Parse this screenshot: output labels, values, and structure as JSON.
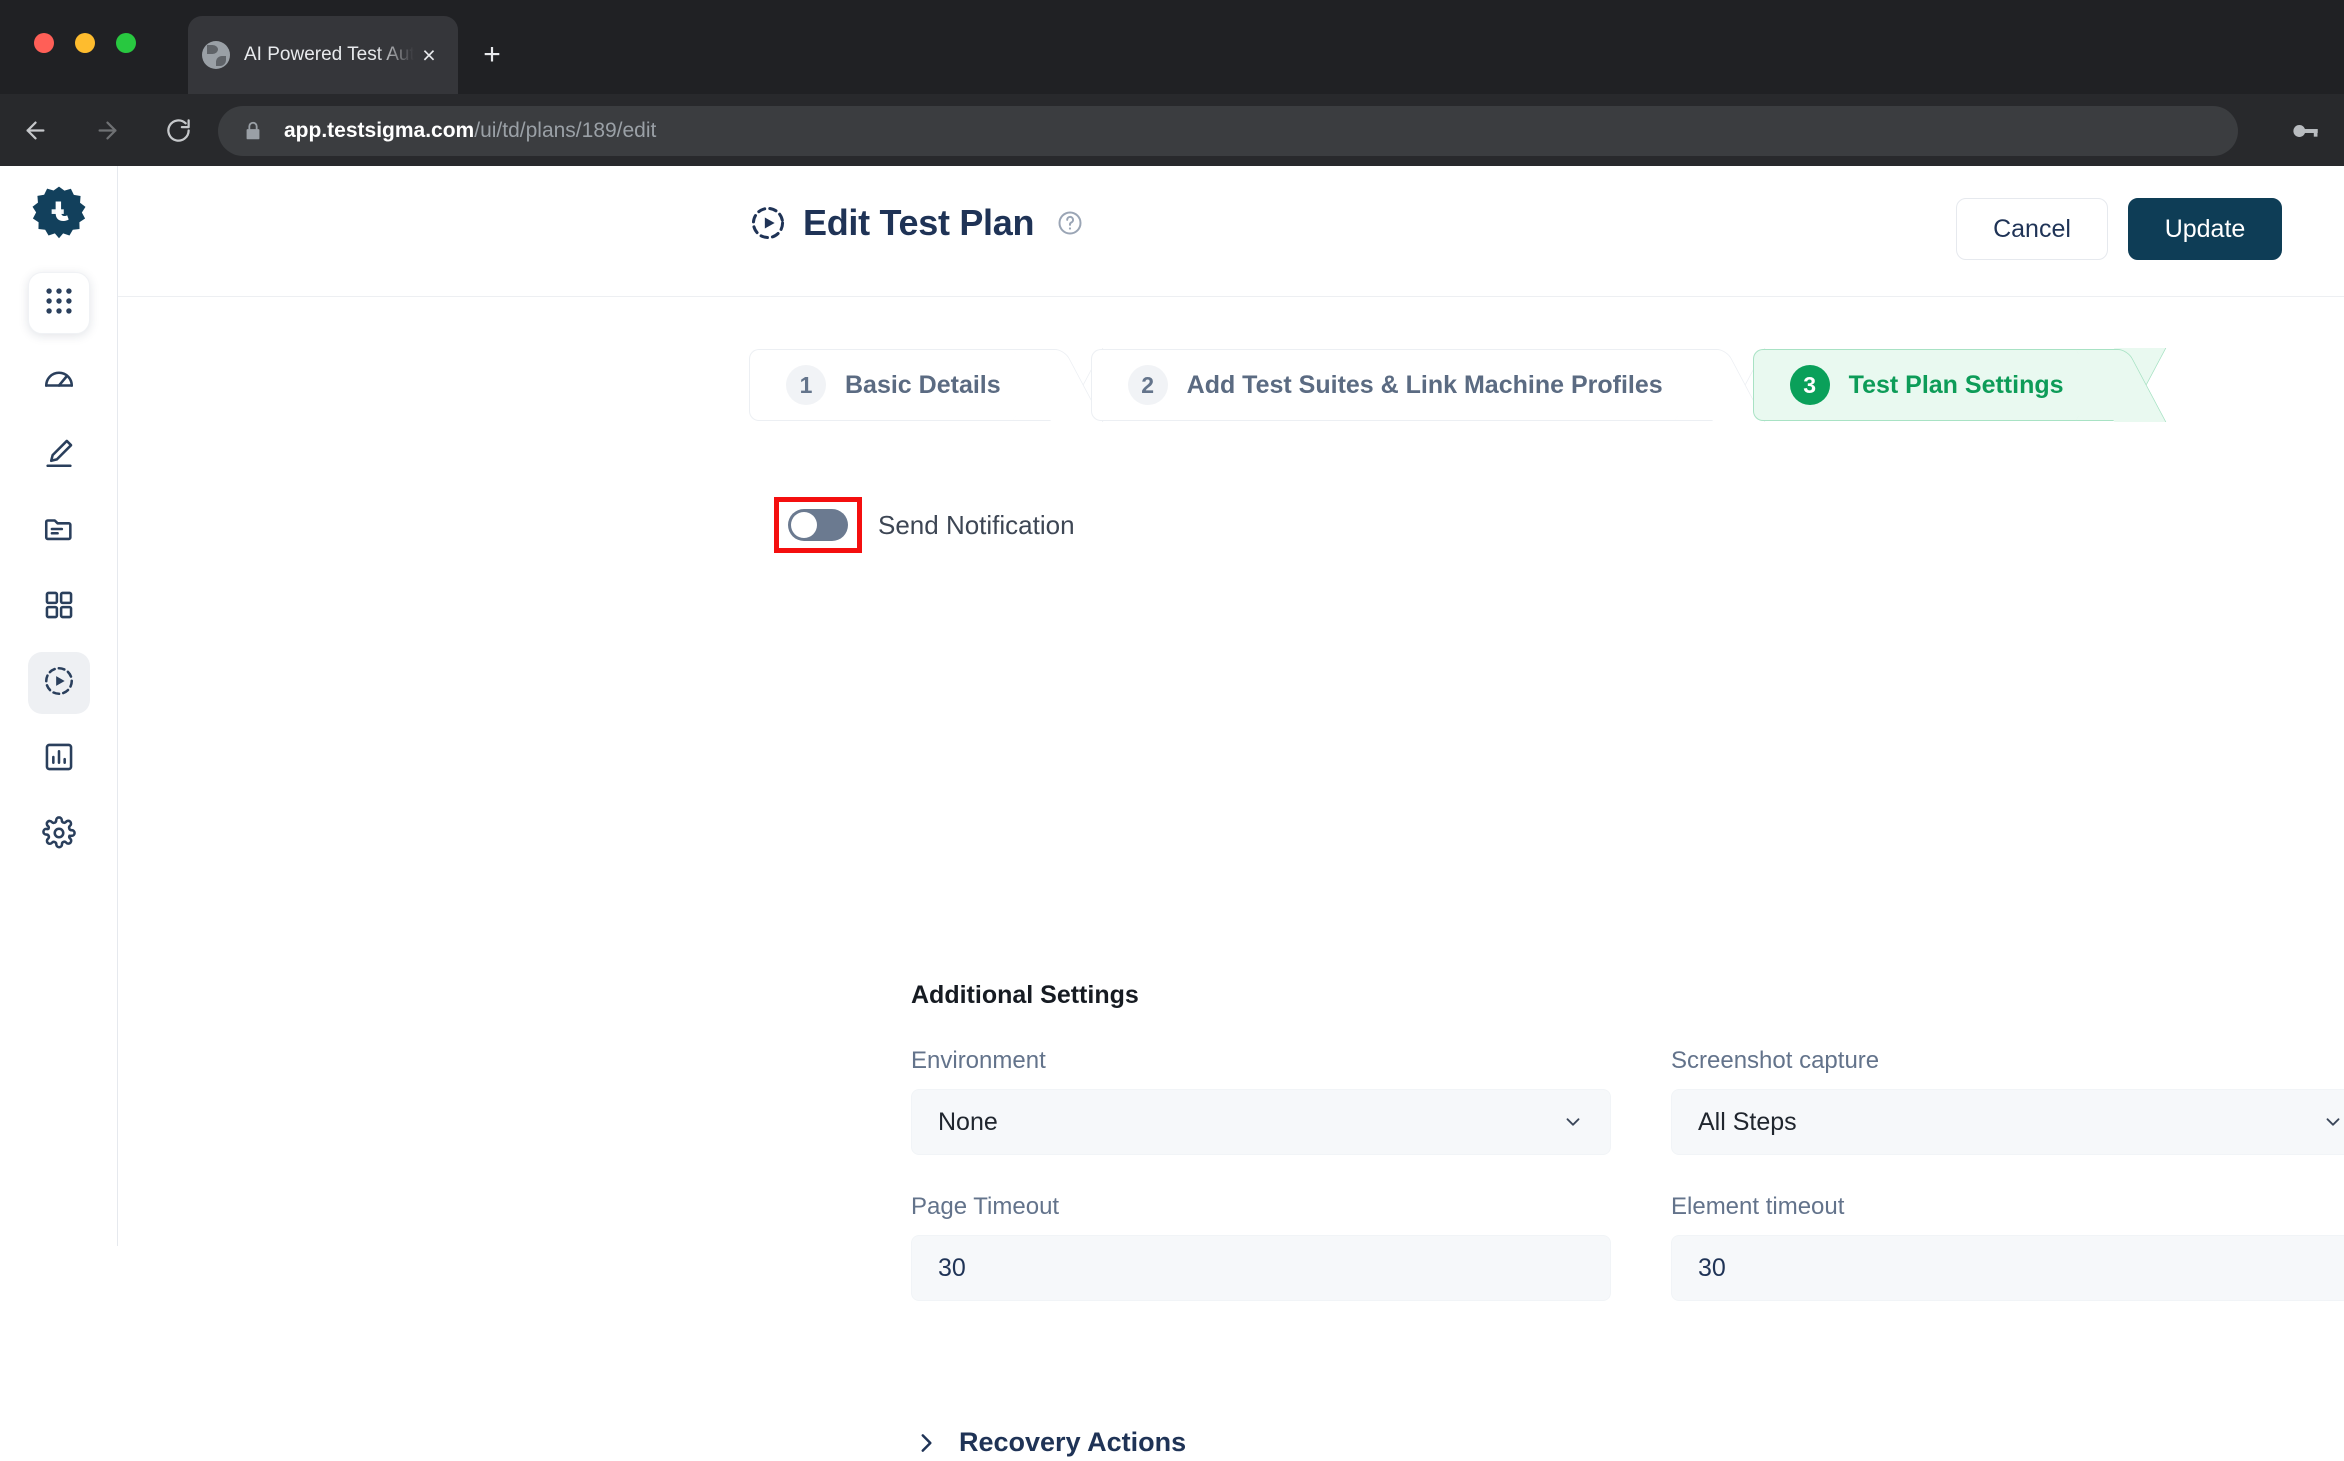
{
  "browser": {
    "tab": {
      "title": "AI Powered Test Automation Platform",
      "favicon": "globe-icon",
      "close": "×"
    },
    "new_tab_label": "+",
    "nav": {
      "back": "back-arrow-icon",
      "forward": "forward-arrow-icon",
      "reload": "reload-icon"
    },
    "omnibox": {
      "lock": "lock-icon",
      "host": "app.testsigma.com",
      "path": "/ui/td/plans/189/edit"
    },
    "key_icon": "key-icon"
  },
  "sidebar": {
    "logo": "testsigma-logo",
    "items": [
      {
        "icon": "apps-grid-icon",
        "name": "apps",
        "state": "boxed"
      },
      {
        "icon": "speedometer-icon",
        "name": "dashboard",
        "state": ""
      },
      {
        "icon": "pencil-icon",
        "name": "create-tests",
        "state": ""
      },
      {
        "icon": "folder-icon",
        "name": "test-cases",
        "state": ""
      },
      {
        "icon": "modules-grid-icon",
        "name": "test-suites",
        "state": ""
      },
      {
        "icon": "play-circle-icon",
        "name": "test-plans",
        "state": "active"
      },
      {
        "icon": "bar-chart-icon",
        "name": "reports",
        "state": ""
      },
      {
        "icon": "gear-icon",
        "name": "settings",
        "state": ""
      }
    ]
  },
  "header": {
    "title": "Edit Test Plan",
    "title_icon": "play-circle-icon",
    "help_icon": "question-circle-icon",
    "cancel_label": "Cancel",
    "update_label": "Update"
  },
  "stepper": {
    "steps": [
      {
        "number": "1",
        "label": "Basic Details",
        "active": false
      },
      {
        "number": "2",
        "label": "Add Test Suites & Link Machine Profiles",
        "active": false
      },
      {
        "number": "3",
        "label": "Test Plan Settings",
        "active": true
      }
    ]
  },
  "settings": {
    "send_notification": {
      "label": "Send Notification",
      "value": "off",
      "highlighted": true
    },
    "section_title": "Additional Settings",
    "fields": [
      {
        "label": "Environment",
        "value": "None",
        "type": "select"
      },
      {
        "label": "Screenshot capture",
        "value": "All Steps",
        "type": "select"
      },
      {
        "label": "Page Timeout",
        "value": "30",
        "type": "input"
      },
      {
        "label": "Element timeout",
        "value": "30",
        "type": "input"
      }
    ],
    "recovery_actions": {
      "label": "Recovery Actions",
      "expanded": false,
      "icon": "chevron-right-icon"
    }
  },
  "colors": {
    "accent_dark": "#0e3d56",
    "active_green": "#0aa05a",
    "active_green_bg": "#e9f9f0",
    "highlight_red": "#f40f0f",
    "text_navy": "#1f3356",
    "field_bg": "#f6f8fa"
  }
}
